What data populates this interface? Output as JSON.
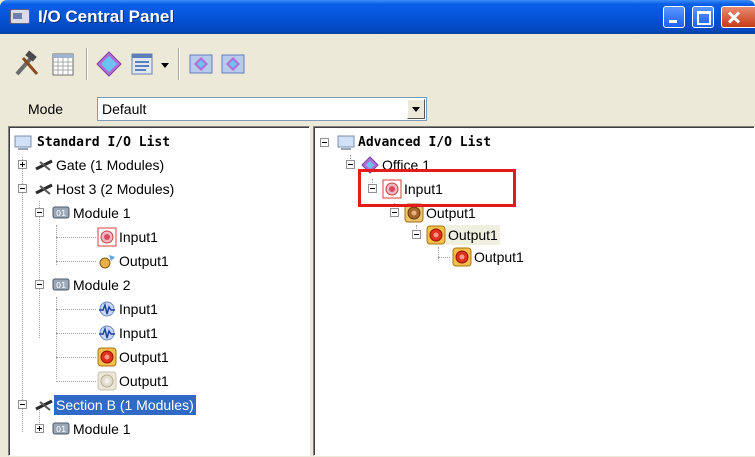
{
  "window": {
    "title": "I/O Central Panel"
  },
  "toolbar": {
    "buttons": [
      "tools-icon",
      "grid-icon",
      "diamond-icon",
      "list-icon",
      "dropdown-arrow",
      "forward-diamond-icon",
      "back-diamond-icon"
    ]
  },
  "mode": {
    "label": "Mode",
    "value": "Default"
  },
  "left_tree": {
    "root": "Standard I/O List",
    "items": [
      "Gate (1 Modules)",
      "Host 3 (2 Modules)",
      "Module 1",
      "Input1",
      "Output1",
      "Module 2",
      "Input1",
      "Input1",
      "Output1",
      "Output1",
      "Section B (1 Modules)",
      "Module 1"
    ]
  },
  "right_tree": {
    "root": "Advanced I/O List",
    "items": [
      "Office 1",
      "Input1",
      "Output1",
      "Output1",
      "Output1"
    ]
  },
  "colors": {
    "titlebar": "#0553d6",
    "selection": "#316ac5",
    "highlight_box": "#e31b1b"
  }
}
